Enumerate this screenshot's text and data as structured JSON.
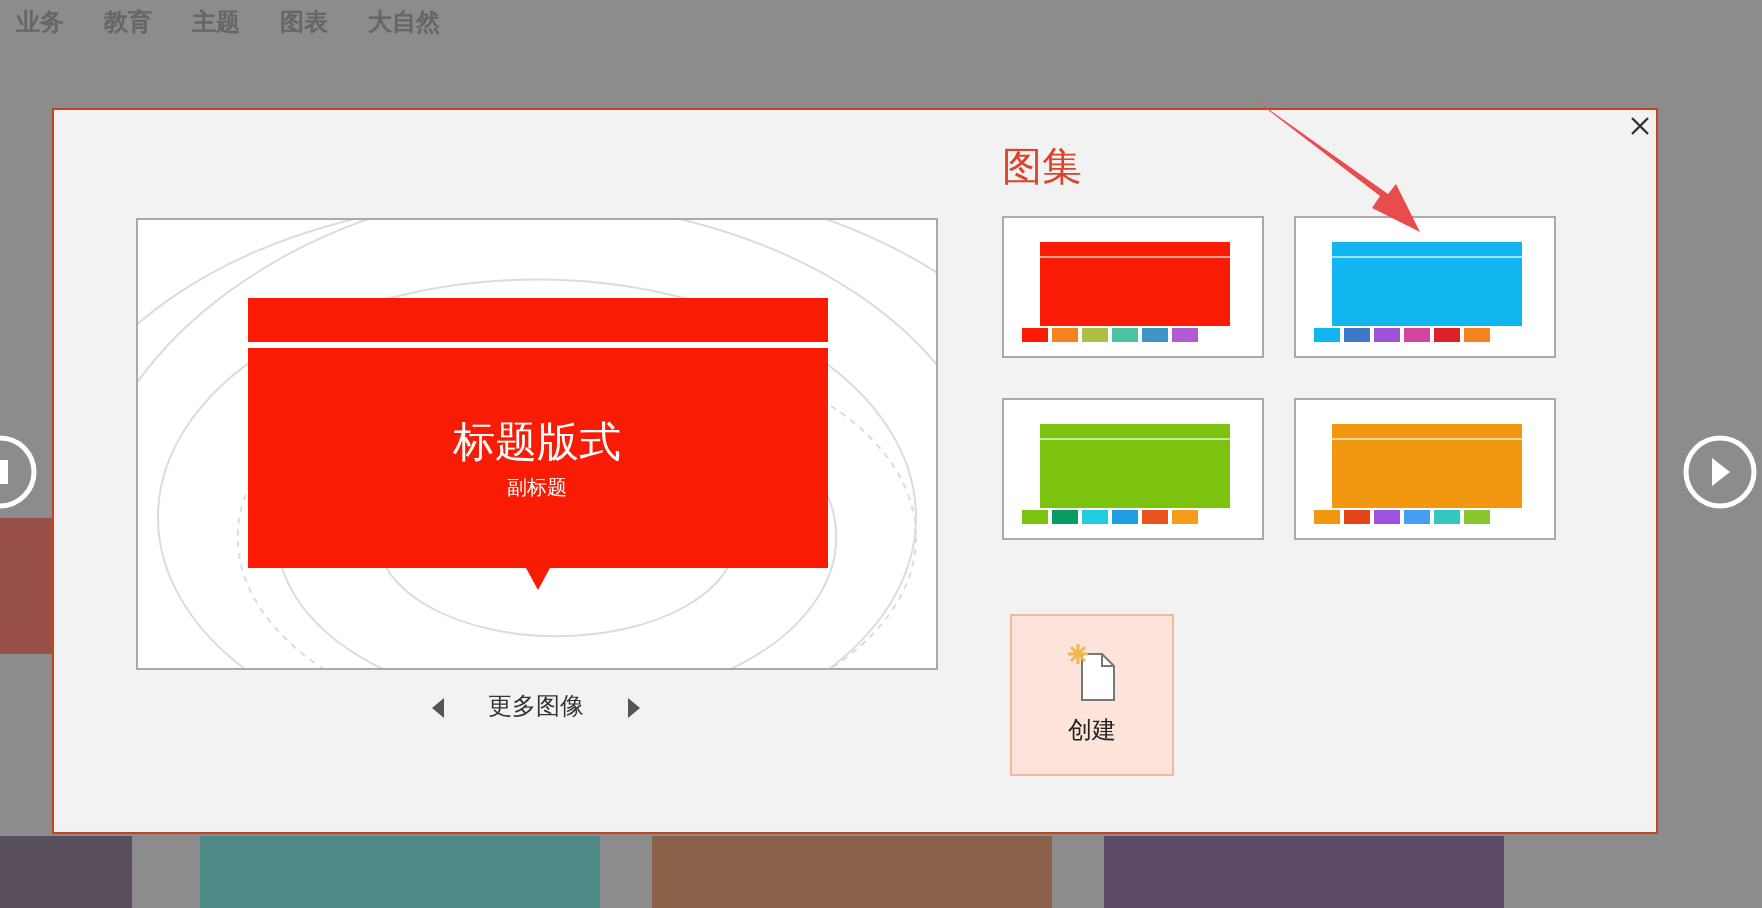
{
  "category_tabs": [
    {
      "label": "业务"
    },
    {
      "label": "教育"
    },
    {
      "label": "主题"
    },
    {
      "label": "图表"
    },
    {
      "label": "大自然"
    }
  ],
  "background_templates": [
    {
      "color": "#4f8a86"
    },
    {
      "color": "#8a6048"
    },
    {
      "color": "#5c4a66"
    }
  ],
  "dialog": {
    "preview": {
      "title": "标题版式",
      "subtitle": "副标题",
      "color": "#f91b03"
    },
    "more_images": "更多图像",
    "gallery": {
      "title": "图集",
      "themes": [
        {
          "color": "#f91b03",
          "swatches": [
            {
              "color": "#f91b03"
            },
            {
              "color": "#f5821f"
            },
            {
              "color": "#aebe45"
            },
            {
              "color": "#4dc2a0"
            },
            {
              "color": "#3f94c6"
            },
            {
              "color": "#b15cd0"
            }
          ]
        },
        {
          "color": "#11b6f0",
          "swatches": [
            {
              "color": "#11b6f0"
            },
            {
              "color": "#3e78c6"
            },
            {
              "color": "#9e52d8"
            },
            {
              "color": "#d2449e"
            },
            {
              "color": "#dc2129"
            },
            {
              "color": "#f5821f"
            }
          ]
        },
        {
          "color": "#7cc30f",
          "swatches": [
            {
              "color": "#7cc30f"
            },
            {
              "color": "#079c62"
            },
            {
              "color": "#20cedf"
            },
            {
              "color": "#1c9ee0"
            },
            {
              "color": "#e8541c"
            },
            {
              "color": "#f59c1c"
            }
          ]
        },
        {
          "color": "#f29710",
          "swatches": [
            {
              "color": "#f29710"
            },
            {
              "color": "#e34419"
            },
            {
              "color": "#9e52e0"
            },
            {
              "color": "#449ef2"
            },
            {
              "color": "#34c6c0"
            },
            {
              "color": "#8ac630"
            }
          ]
        }
      ]
    },
    "create_button": "创建"
  }
}
